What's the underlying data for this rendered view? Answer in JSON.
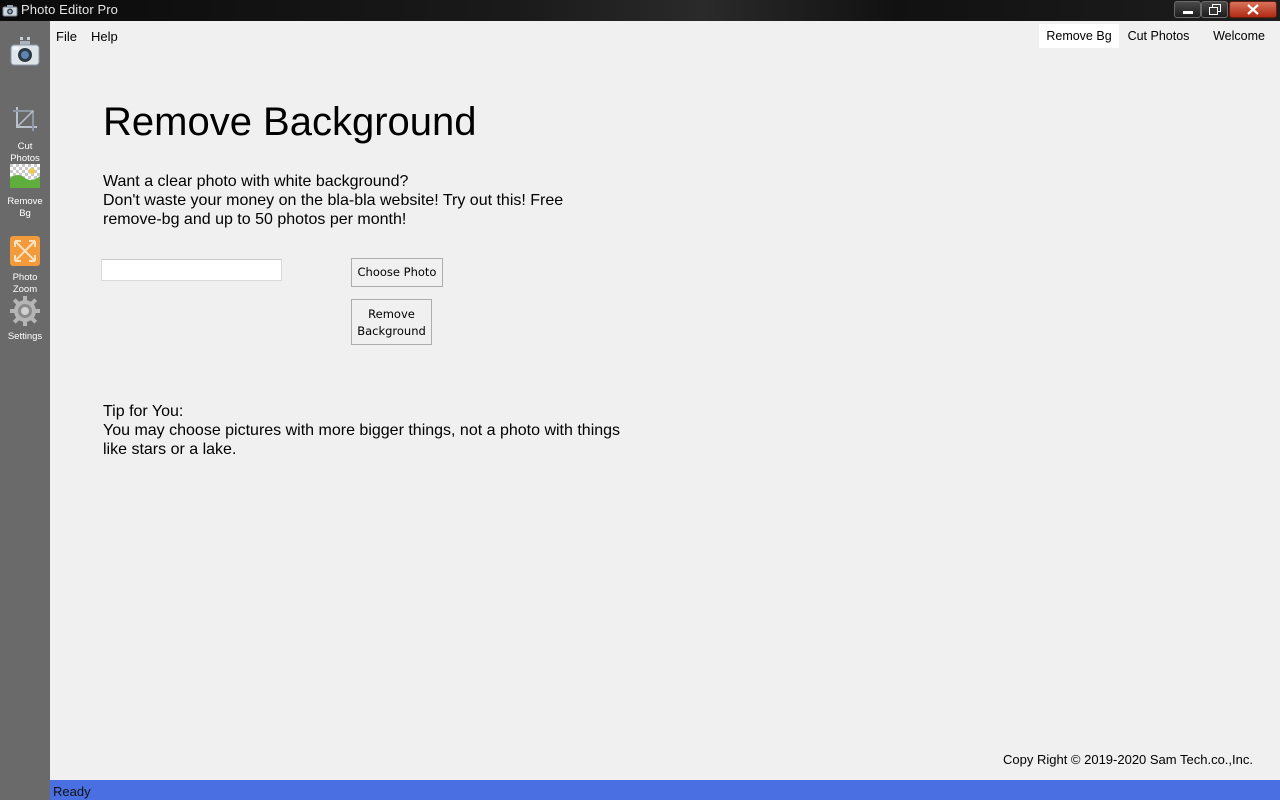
{
  "window": {
    "title": "Photo Editor Pro"
  },
  "sidebar": {
    "items": [
      {
        "name": "camera",
        "label": ""
      },
      {
        "name": "cut-photos",
        "label": "Cut Photos"
      },
      {
        "name": "remove-bg",
        "label": "Remove Bg"
      },
      {
        "name": "photo-zoom",
        "label": "Photo Zoom"
      },
      {
        "name": "settings",
        "label": "Settings"
      }
    ]
  },
  "menu": {
    "file": "File",
    "help": "Help"
  },
  "tabs": [
    {
      "label": "Remove Bg",
      "active": true
    },
    {
      "label": "Cut Photos",
      "active": false
    },
    {
      "label": "Welcome",
      "active": false
    }
  ],
  "main": {
    "title": "Remove Background",
    "description": "Want a clear photo with white background?\nDon't waste your money on the bla-bla website! Try out this! Free remove-bg and up to 50 photos per month!",
    "path_value": "",
    "choose_button": "Choose Photo",
    "remove_button": "Remove\nBackground",
    "tip_title": "Tip for You:",
    "tip_text": "You may choose pictures with more bigger things, not a photo with things like stars or a lake."
  },
  "footer": {
    "copyright": "Copy Right © 2019-2020 Sam Tech.co.,Inc."
  },
  "status": {
    "text": "Ready"
  },
  "colors": {
    "status_bar": "#4a6fe3",
    "sidebar": "#6a6a6a",
    "content_bg": "#f0f0f0"
  }
}
